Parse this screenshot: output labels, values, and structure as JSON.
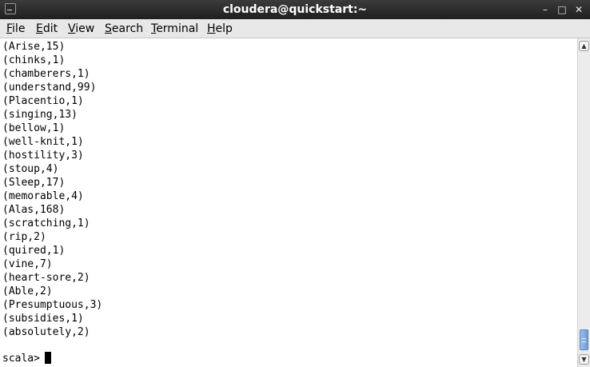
{
  "window": {
    "title": "cloudera@quickstart:~",
    "controls": {
      "minimize": "–",
      "maximize": "□",
      "close": "✕"
    }
  },
  "menu": {
    "items": [
      {
        "label": "File",
        "accel": "F",
        "rest": "ile"
      },
      {
        "label": "Edit",
        "accel": "E",
        "rest": "dit"
      },
      {
        "label": "View",
        "accel": "V",
        "rest": "iew"
      },
      {
        "label": "Search",
        "accel": "S",
        "rest": "earch"
      },
      {
        "label": "Terminal",
        "accel": "T",
        "rest": "erminal"
      },
      {
        "label": "Help",
        "accel": "H",
        "rest": "elp"
      }
    ]
  },
  "terminal": {
    "lines": [
      "(Arise,15)",
      "(chinks,1)",
      "(chamberers,1)",
      "(understand,99)",
      "(Placentio,1)",
      "(singing,13)",
      "(bellow,1)",
      "(well-knit,1)",
      "(hostility,3)",
      "(stoup,4)",
      "(Sleep,17)",
      "(memorable,4)",
      "(Alas,168)",
      "(scratching,1)",
      "(rip,2)",
      "(quired,1)",
      "(vine,7)",
      "(heart-sore,2)",
      "(Able,2)",
      "(Presumptuous,3)",
      "(subsidies,1)",
      "(absolutely,2)"
    ],
    "prompt": "scala>"
  }
}
